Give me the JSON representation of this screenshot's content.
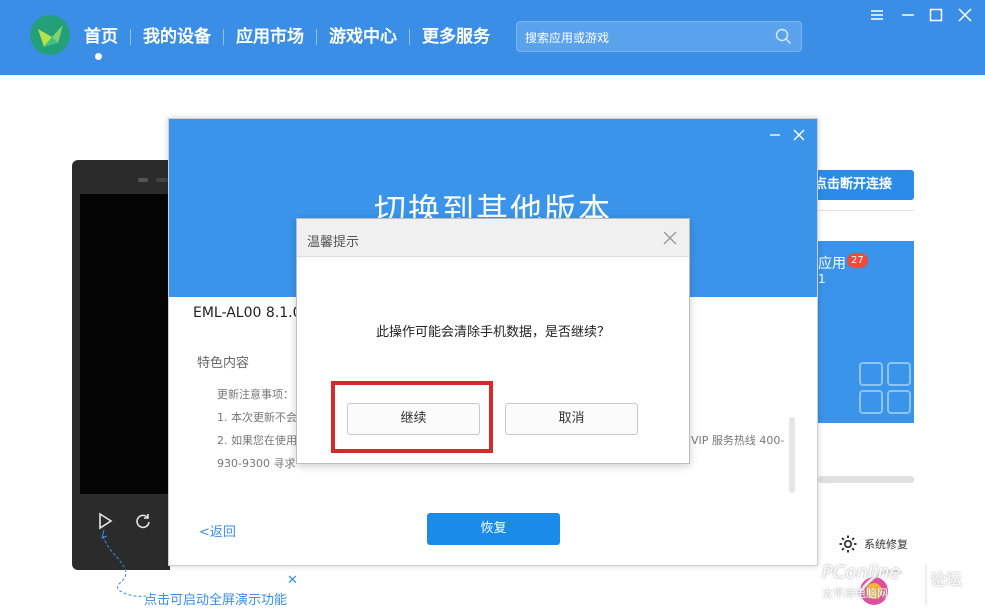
{
  "topbar": {
    "nav": [
      {
        "label": "首页"
      },
      {
        "label": "我的设备"
      },
      {
        "label": "应用市场"
      },
      {
        "label": "游戏中心"
      },
      {
        "label": "更多服务"
      }
    ],
    "search_placeholder": "搜索应用或游戏",
    "accent": "#3a8ee6"
  },
  "background": {
    "disconnect_label": "点击断开连接",
    "app_tile_label": "应用",
    "app_tile_badge": "27",
    "app_tile_sub": "1",
    "repair_label": "系统修复",
    "phone_hint": "点击可启动全屏演示功能",
    "watermark_1": "PConline",
    "watermark_2": "论坛",
    "watermark_3": "太平洋电脑网"
  },
  "version_dialog": {
    "title": "切换到其他版本",
    "version": "EML-AL00 8.1.0",
    "section_label": "特色内容",
    "lines": [
      "更新注意事项：",
      "1. 本次更新不会",
      "2. 如果您在使用",
      "VIP 服务热线 400-",
      "930-9300 寻求"
    ],
    "back_label": "<返回",
    "restore_label": "恢复"
  },
  "confirm_dialog": {
    "title": "温馨提示",
    "message": "此操作可能会清除手机数据，是否继续？",
    "continue_label": "继续",
    "cancel_label": "取消",
    "highlight_color": "#d42a2a"
  }
}
